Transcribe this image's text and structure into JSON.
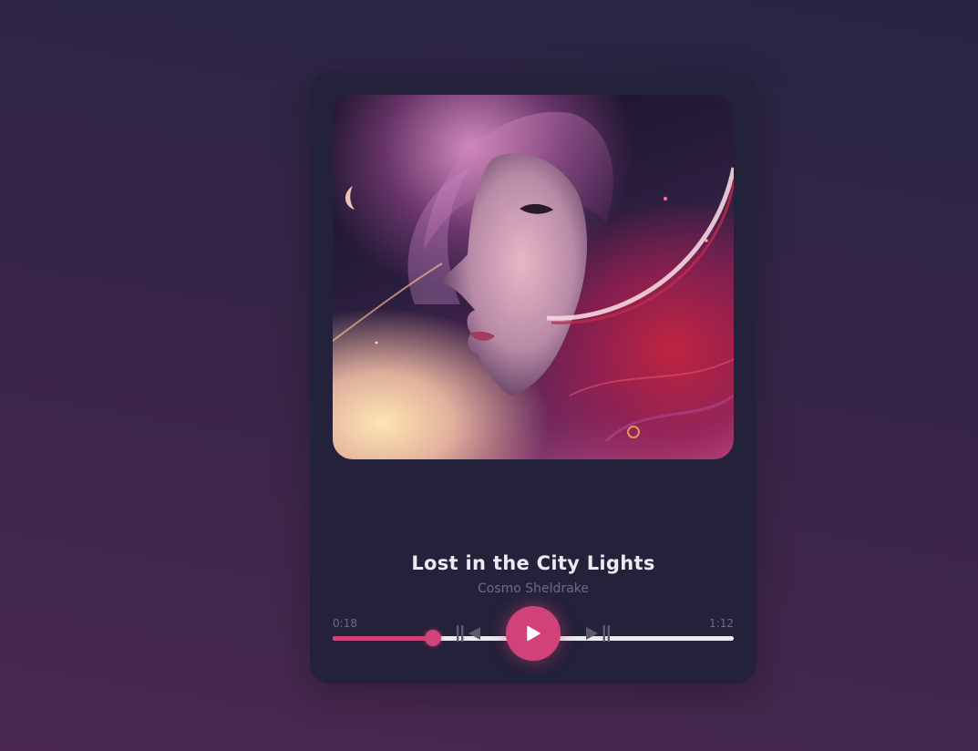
{
  "player": {
    "title": "Lost in the City Lights",
    "artist": "Cosmo Sheldrake",
    "current_time": "0:18",
    "total_time": "1:12",
    "progress": 0.25
  },
  "controls": {
    "previous_icon": "skip-previous-icon",
    "play_icon": "play-icon",
    "next_icon": "skip-next-icon"
  },
  "colors": {
    "accent": "#d14378",
    "card": "#24213a",
    "title_text": "#ecebf2",
    "muted_text": "#6e6a86",
    "control_gray": "#5c5a6e"
  }
}
